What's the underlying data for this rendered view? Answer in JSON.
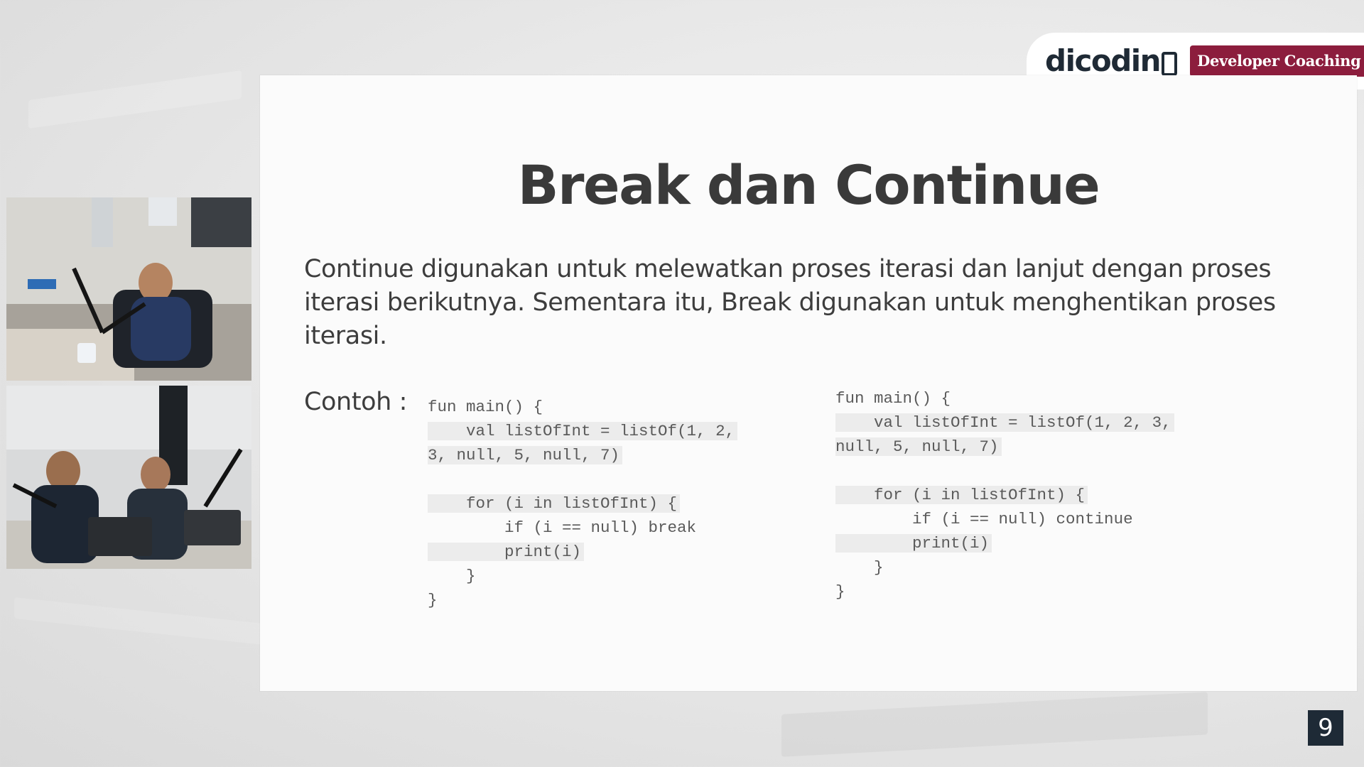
{
  "brand": {
    "logo_text": "dicodin",
    "badge": "Developer Coaching"
  },
  "slide": {
    "title": "Break dan Continue",
    "description": "Continue digunakan untuk melewatkan proses iterasi dan lanjut dengan proses iterasi berikutnya. Sementara itu, Break digunakan untuk menghentikan proses iterasi.",
    "example_label": "Contoh :",
    "code_left": [
      {
        "text": "fun main() {",
        "highlight": false
      },
      {
        "text": "    val listOfInt = listOf(1, 2,",
        "highlight": true
      },
      {
        "text": "3, null, 5, null, 7)",
        "highlight": true
      },
      {
        "text": "",
        "highlight": false
      },
      {
        "text": "    for (i in listOfInt) {",
        "highlight": true
      },
      {
        "text": "        if (i == null) break",
        "highlight": false
      },
      {
        "text": "        print(i)",
        "highlight": true
      },
      {
        "text": "    }",
        "highlight": false
      },
      {
        "text": "}",
        "highlight": false
      }
    ],
    "code_right": [
      {
        "text": "fun main() {",
        "highlight": false
      },
      {
        "text": "    val listOfInt = listOf(1, 2, 3,",
        "highlight": true
      },
      {
        "text": "null, 5, null, 7)",
        "highlight": true
      },
      {
        "text": "",
        "highlight": false
      },
      {
        "text": "    for (i in listOfInt) {",
        "highlight": true
      },
      {
        "text": "        if (i == null) continue",
        "highlight": false
      },
      {
        "text": "        print(i)",
        "highlight": true
      },
      {
        "text": "    }",
        "highlight": false
      },
      {
        "text": "}",
        "highlight": false
      }
    ]
  },
  "page_number": "9",
  "colors": {
    "badge_bg": "#8c1d3d",
    "title": "#3a3a3a",
    "page_number_bg": "#1e2a36"
  }
}
